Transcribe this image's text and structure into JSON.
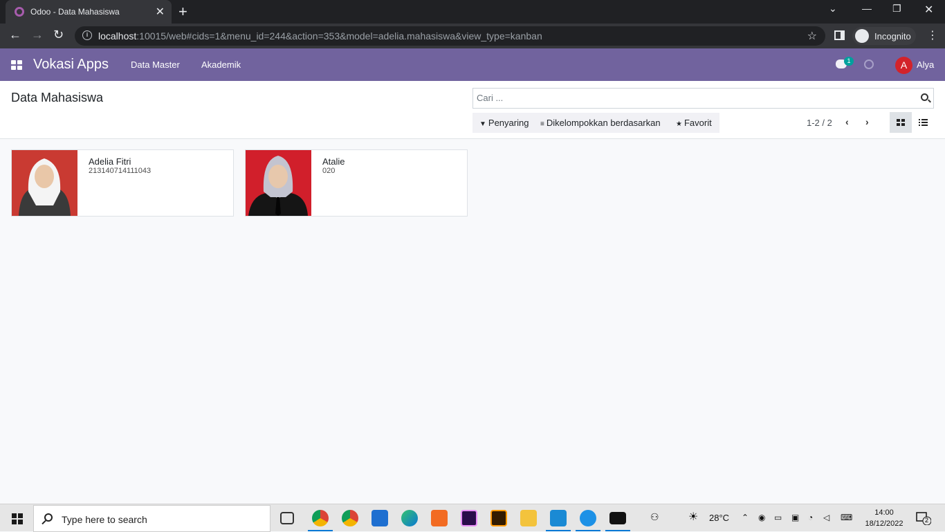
{
  "browser": {
    "tab_title": "Odoo - Data Mahasiswa",
    "url_host": "localhost",
    "url_rest": ":10015/web#cids=1&menu_id=244&action=353&model=adelia.mahasiswa&view_type=kanban",
    "incognito_label": "Incognito"
  },
  "navbar": {
    "brand": "Vokasi Apps",
    "menus": [
      "Data Master",
      "Akademik"
    ],
    "chat_badge": "1",
    "avatar_initial": "A",
    "user": "Alya"
  },
  "control_panel": {
    "breadcrumb": "Data Mahasiswa",
    "search_placeholder": "Cari ...",
    "filters": {
      "filter": "Penyaring",
      "group_by": "Dikelompokkan berdasarkan",
      "favorites": "Favorit"
    },
    "pager": "1-2 / 2",
    "active_view": "kanban"
  },
  "records": [
    {
      "name": "Adelia Fitri",
      "nim": "213140714111043"
    },
    {
      "name": "Atalie",
      "nim": "020"
    }
  ],
  "taskbar": {
    "search_placeholder": "Type here to search",
    "temperature": "28°C",
    "time": "14:00",
    "date": "18/12/2022",
    "notification_count": "2"
  },
  "colors": {
    "navbar": "#71639e",
    "accent": "#00a09d",
    "avatar": "#d3232a"
  }
}
